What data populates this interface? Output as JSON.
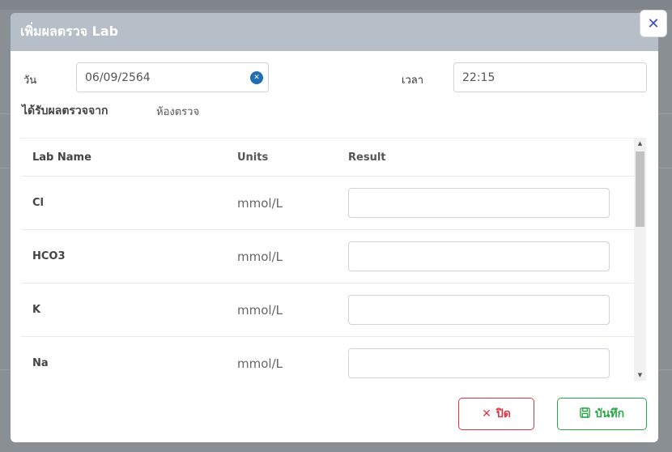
{
  "modal": {
    "title": "เพิ่มผลตรวจ Lab",
    "close_icon": "close-icon"
  },
  "form": {
    "date_label": "วัน",
    "date_value": "06/09/2564",
    "time_label": "เวลา",
    "time_value": "22:15",
    "source_label": "ได้รับผลตรวจจาก",
    "source_value": "ห้องตรวจ"
  },
  "table": {
    "headers": [
      "Lab Name",
      "Units",
      "Result"
    ],
    "rows": [
      {
        "name": "Cl",
        "unit": "mmol/L",
        "result": ""
      },
      {
        "name": "HCO3",
        "unit": "mmol/L",
        "result": ""
      },
      {
        "name": "K",
        "unit": "mmol/L",
        "result": ""
      },
      {
        "name": "Na",
        "unit": "mmol/L",
        "result": ""
      }
    ]
  },
  "buttons": {
    "close_label": "ปิด",
    "save_label": "บันทึก"
  },
  "colors": {
    "header_bg": "#b6bec7",
    "danger": "#dc3545",
    "success": "#28a745",
    "accent": "#1f6fb2"
  }
}
